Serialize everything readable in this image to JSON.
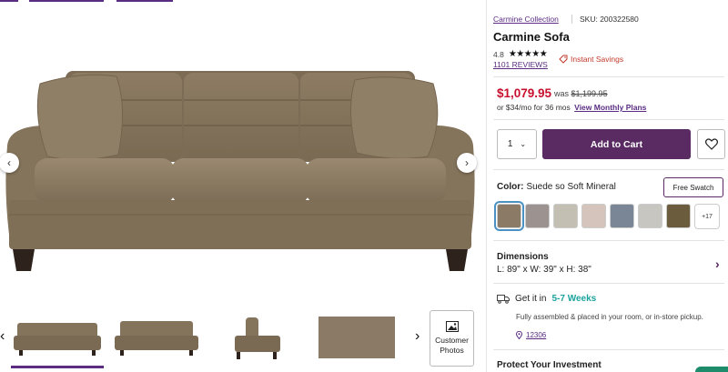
{
  "product": {
    "collection": "Carmine Collection",
    "sku": "SKU: 200322580",
    "title": "Carmine Sofa",
    "rating": "4.8",
    "stars": "★★★★★",
    "reviews": "1101 REVIEWS",
    "instant_savings": "Instant Savings"
  },
  "pricing": {
    "price": "$1,079.95",
    "was_label": "was",
    "was_price": "$1,199.95",
    "monthly": "or $34/mo for 36 mos",
    "monthly_link": "View Monthly Plans"
  },
  "purchase": {
    "quantity": "1",
    "add_to_cart": "Add to Cart"
  },
  "color": {
    "label": "Color:",
    "value": "Suede so Soft Mineral",
    "free_swatch": "Free Swatch",
    "more": "+17",
    "swatches": [
      "#8a7a66",
      "#9c9391",
      "#c3bfb3",
      "#d4c4bc",
      "#7a8596",
      "#c8c6c1",
      "#6b5c3e"
    ]
  },
  "dimensions": {
    "title": "Dimensions",
    "value": "L: 89\" x W: 39\" x H: 38\""
  },
  "delivery": {
    "get_it": "Get it in",
    "weeks": "5-7 Weeks",
    "note": "Fully assembled & placed in your room, or in-store pickup.",
    "zip": "12306"
  },
  "protect": "Protect Your Investment",
  "gallery": {
    "customer_photos": "Customer Photos"
  },
  "colors": {
    "brand": "#5a2a63",
    "price": "#c8102e",
    "accent_teal": "#1aa39e",
    "sofa": "#8b7a62"
  }
}
